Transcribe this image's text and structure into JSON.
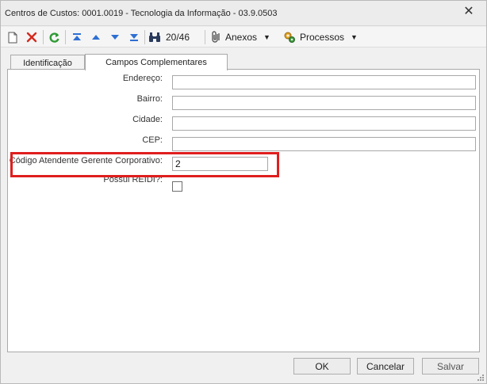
{
  "window": {
    "title": "Centros de Custos: 0001.0019 - Tecnologia da Informação - 03.9.0503",
    "close_glyph": "✕"
  },
  "toolbar": {
    "record_counter": "20/46",
    "attachments_label": "Anexos",
    "processes_label": "Processos",
    "dropdown_glyph": "▼"
  },
  "tabs": [
    {
      "label": "Identificação",
      "active": false
    },
    {
      "label": "Campos Complementares",
      "active": true
    }
  ],
  "form": {
    "endereco": {
      "label": "Endereço:",
      "value": ""
    },
    "bairro": {
      "label": "Bairro:",
      "value": ""
    },
    "cidade": {
      "label": "Cidade:",
      "value": ""
    },
    "cep": {
      "label": "CEP:",
      "value": ""
    },
    "codigo_atendente": {
      "label": "Código Atendente Gerente Corporativo:",
      "value": "2"
    },
    "possui_reidi": {
      "label": "Possui REIDI?:",
      "checked": false
    }
  },
  "footer": {
    "ok_label": "OK",
    "cancel_label": "Cancelar",
    "save_label": "Salvar"
  },
  "colors": {
    "highlight": "#e01e1e",
    "accent_blue": "#2e6fd3",
    "delete_red": "#d42a1e",
    "refresh_green": "#2f9a35"
  }
}
